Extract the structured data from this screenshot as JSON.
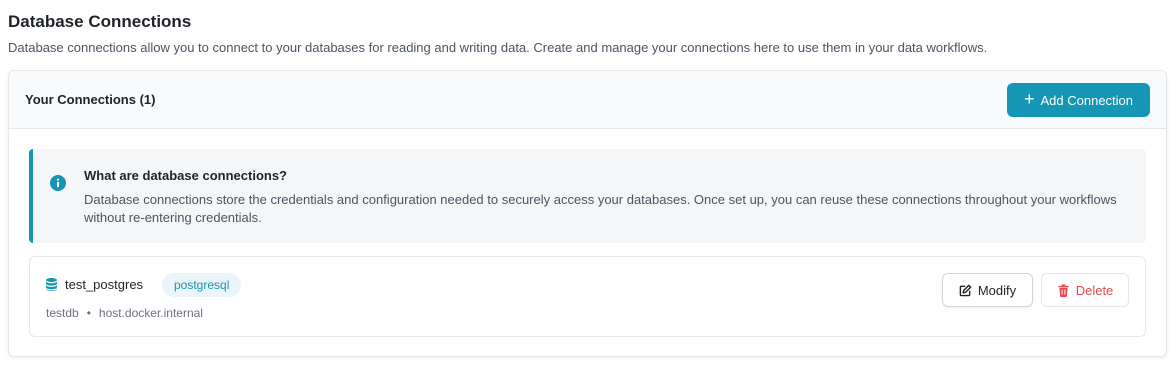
{
  "page": {
    "title": "Database Connections",
    "description": "Database connections allow you to connect to your databases for reading and writing data. Create and manage your connections here to use them in your data workflows."
  },
  "card": {
    "title": "Your Connections (1)",
    "add_button": {
      "icon": "plus-icon",
      "label": "Add Connection"
    }
  },
  "info": {
    "icon": "info-icon",
    "title": "What are database connections?",
    "body": "Database connections store the credentials and configuration needed to securely access your databases. Once set up, you can reuse these connections throughout your workflows without re-entering credentials."
  },
  "connections": [
    {
      "icon": "database-icon",
      "name": "test_postgres",
      "type": "postgresql",
      "database": "testdb",
      "separator": "•",
      "host": "host.docker.internal",
      "modify_label": "Modify",
      "modify_icon": "edit-icon",
      "delete_label": "Delete",
      "delete_icon": "trash-icon"
    }
  ],
  "colors": {
    "accent": "#1596b5",
    "danger": "#e5484d",
    "badge_bg": "#e9f5f8"
  }
}
